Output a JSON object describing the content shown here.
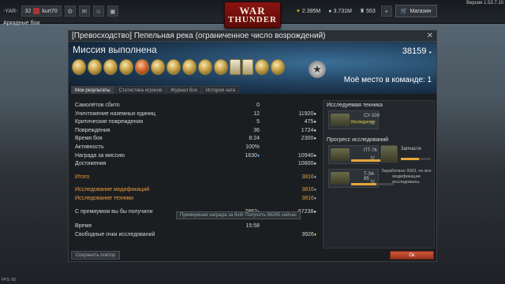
{
  "topbar": {
    "clan_tag": "-YAR-",
    "level": "32",
    "player_name": "kurt70",
    "golden_eagles": "2.395M",
    "silver_lions": "3.731M",
    "research_points": "553",
    "shop_label": "Магазин",
    "version": "Версия 1.53.7.10"
  },
  "logo": {
    "line1": "WAR",
    "line2": "THUNDER"
  },
  "mode_label": "Аркадные бои",
  "dialog": {
    "title": "[Превосходство] Пепельная река (ограниченное число возрождений)",
    "close": "✕",
    "mission_status": "Миссия выполнена",
    "score": "38159",
    "team_place": "Моё место в команде: 1",
    "tabs": [
      "Мои результаты",
      "Статистика игроков",
      "Журнал боя",
      "История чата"
    ]
  },
  "stats": {
    "rows": [
      {
        "label": "Самолётов сбито",
        "count": "0",
        "reward": ""
      },
      {
        "label": "Уничтожение наземных единиц",
        "count": "12",
        "reward": "11920"
      },
      {
        "label": "Критические повреждения",
        "count": "5",
        "reward": "475"
      },
      {
        "label": "Повреждения",
        "count": "36",
        "reward": "1724"
      },
      {
        "label": "Время боя",
        "count": "8:24",
        "reward": "2300"
      },
      {
        "label": "Активность",
        "count": "100%",
        "reward": ""
      },
      {
        "label": "Награда за миссию",
        "count": "1630",
        "reward": "10940"
      },
      {
        "label": "Достижения",
        "count": "",
        "reward": "10800"
      }
    ],
    "total_label": "Итого",
    "total_value": "3816",
    "mods_label": "Исследование модификаций",
    "mods_value": "3816",
    "vehicles_label": "Исследование техники",
    "vehicles_value": "3816",
    "premium_label": "С премиумом вы бы получили",
    "premium_rp": "7852",
    "premium_sl": "57238",
    "tooltip": "Премиумная награда за бой! Получить 96265 сейчас",
    "time_label": "Время",
    "time_value": "15:58",
    "free_rp_label": "Свободные очки исследований",
    "free_rp_value": "3926"
  },
  "research": {
    "title": "Исследуемая техника",
    "vehicle_name": "СУ-100",
    "vehicle_status": "Исследуется",
    "vehicle_rank": "IV",
    "progress_title": "Прогресс исследований",
    "tank1_name": "ПТ-76",
    "tank1_rank": "IV",
    "tank1_progress": 0.75,
    "tank2_name": "Т-34-85",
    "tank2_rank": "IV",
    "tank2_progress": 0.6,
    "parts_name": "Запчасти",
    "parts_progress": 0.6,
    "earned_text": "Заработано 3363, но все модификации исследованы."
  },
  "footer": {
    "share": "Сохранить повтор",
    "ok": "Ок",
    "fps": "FPS: 60"
  },
  "colors": {
    "accent_orange": "#e89a3c",
    "ok_button": "#d0573a",
    "logo_red": "#8a1410"
  }
}
